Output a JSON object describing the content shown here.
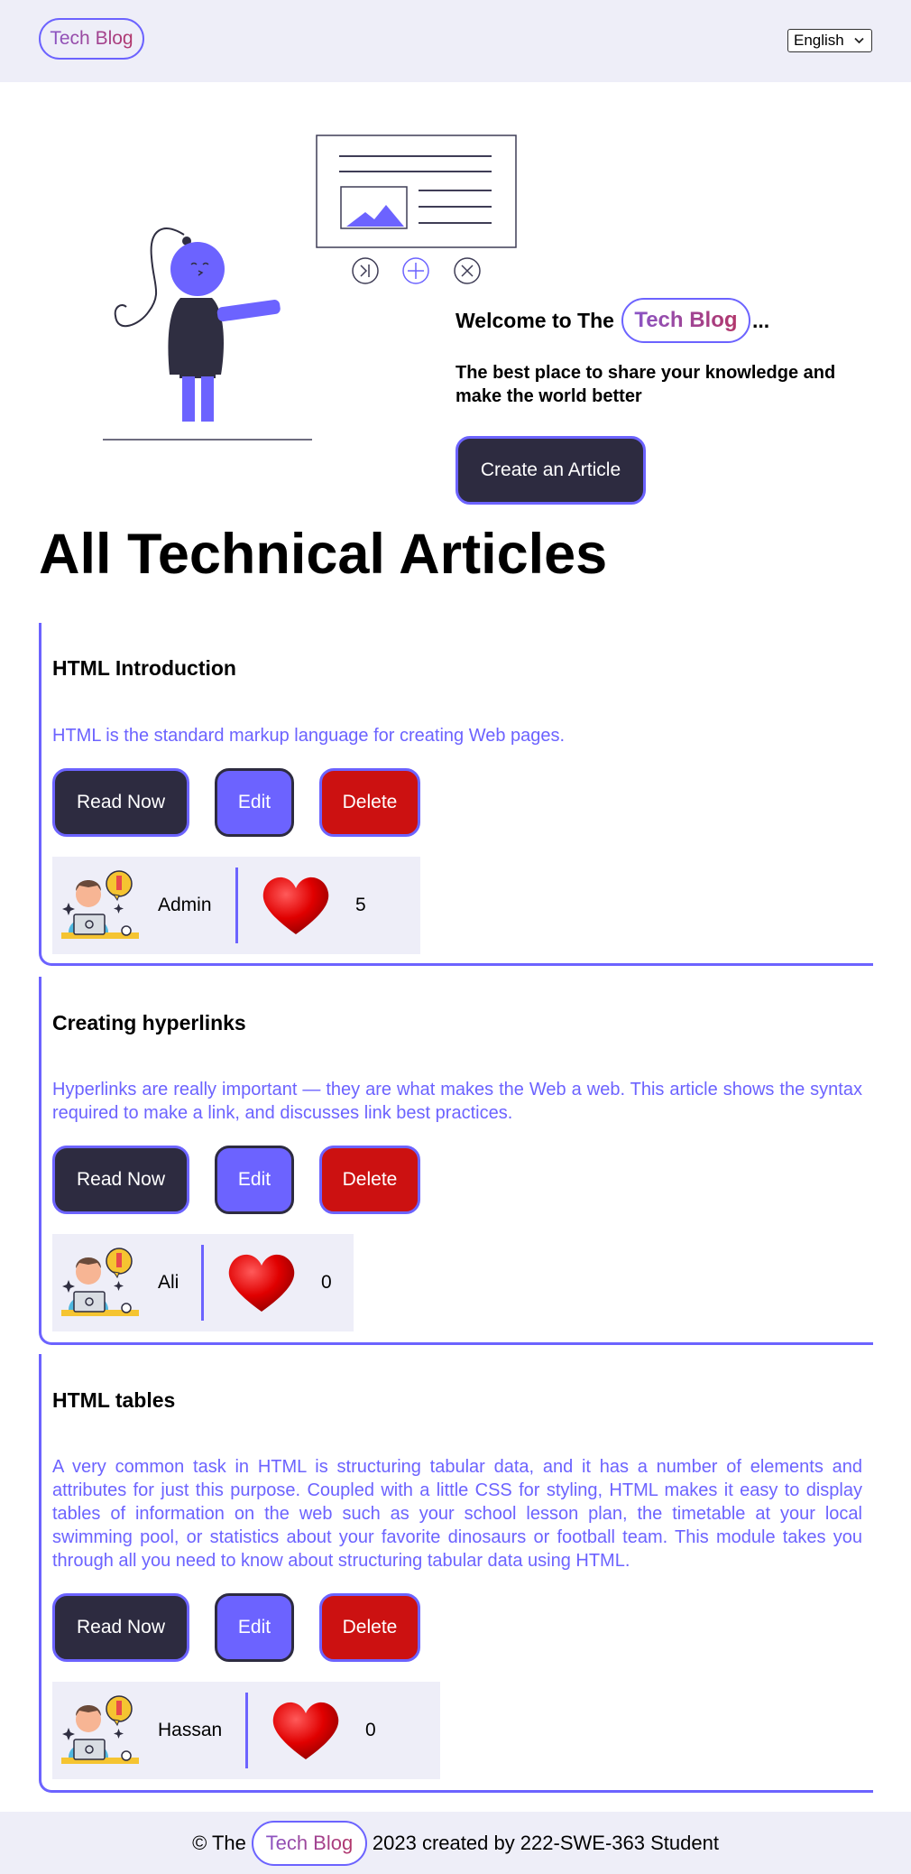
{
  "header": {
    "logo_text": "Tech Blog",
    "language": "English"
  },
  "hero": {
    "welcome_prefix": "Welcome to The",
    "brand": "Tech Blog",
    "welcome_suffix": "...",
    "tagline": "The best place to share your knowledge and make the world better",
    "create_button": "Create an Article"
  },
  "section_title": "All Technical Articles",
  "buttons": {
    "read": "Read Now",
    "edit": "Edit",
    "delete": "Delete"
  },
  "articles": [
    {
      "title": "HTML Introduction",
      "description": "HTML is the standard markup language for creating Web pages.",
      "author": "Admin",
      "likes": "5"
    },
    {
      "title": "Creating hyperlinks",
      "description": "Hyperlinks are really important — they are what makes the Web a web. This article shows the syntax required to make a link, and discusses link best practices.",
      "author": "Ali",
      "likes": "0"
    },
    {
      "title": "HTML tables",
      "description": "A very common task in HTML is structuring tabular data, and it has a number of elements and attributes for just this purpose. Coupled with a little CSS for styling, HTML makes it easy to display tables of information on the web such as your school lesson plan, the timetable at your local swimming pool, or statistics about your favorite dinosaurs or football team. This module takes you through all you need to know about structuring tabular data using HTML.",
      "author": "Hassan",
      "likes": "0"
    }
  ],
  "footer": {
    "prefix": "© The",
    "brand": "Tech Blog",
    "suffix": "2023 created by 222-SWE-363 Student"
  },
  "icons": {
    "language_dropdown": "chevron-down-icon",
    "author_avatar": "developer-avatar-icon",
    "like": "heart-icon",
    "hero": "person-presenting-illustration"
  },
  "colors": {
    "accent": "#6c63ff",
    "dark": "#2d2b40",
    "danger": "#cc1111",
    "panel": "#eeeef8"
  }
}
